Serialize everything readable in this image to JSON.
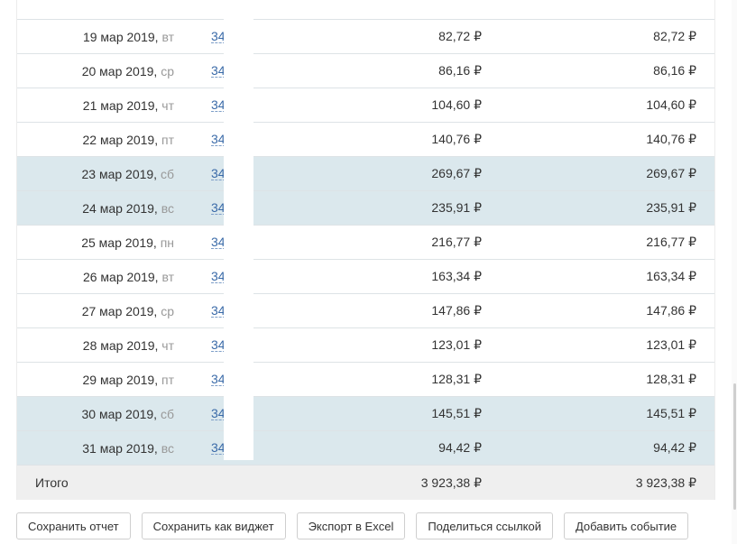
{
  "table": {
    "rows": [
      {
        "date": "19 мар 2019, ",
        "weekday": "вт",
        "link": "34",
        "col2": "82,72 ₽",
        "col3": "82,72 ₽",
        "weekend": false
      },
      {
        "date": "20 мар 2019, ",
        "weekday": "ср",
        "link": "34",
        "col2": "86,16 ₽",
        "col3": "86,16 ₽",
        "weekend": false
      },
      {
        "date": "21 мар 2019, ",
        "weekday": "чт",
        "link": "34",
        "col2": "104,60 ₽",
        "col3": "104,60 ₽",
        "weekend": false
      },
      {
        "date": "22 мар 2019, ",
        "weekday": "пт",
        "link": "34",
        "col2": "140,76 ₽",
        "col3": "140,76 ₽",
        "weekend": false
      },
      {
        "date": "23 мар 2019, ",
        "weekday": "сб",
        "link": "34",
        "col2": "269,67 ₽",
        "col3": "269,67 ₽",
        "weekend": true
      },
      {
        "date": "24 мар 2019, ",
        "weekday": "вс",
        "link": "34",
        "col2": "235,91 ₽",
        "col3": "235,91 ₽",
        "weekend": true
      },
      {
        "date": "25 мар 2019, ",
        "weekday": "пн",
        "link": "34",
        "col2": "216,77 ₽",
        "col3": "216,77 ₽",
        "weekend": false
      },
      {
        "date": "26 мар 2019, ",
        "weekday": "вт",
        "link": "34",
        "col2": "163,34 ₽",
        "col3": "163,34 ₽",
        "weekend": false
      },
      {
        "date": "27 мар 2019, ",
        "weekday": "ср",
        "link": "34",
        "col2": "147,86 ₽",
        "col3": "147,86 ₽",
        "weekend": false
      },
      {
        "date": "28 мар 2019, ",
        "weekday": "чт",
        "link": "34",
        "col2": "123,01 ₽",
        "col3": "123,01 ₽",
        "weekend": false
      },
      {
        "date": "29 мар 2019, ",
        "weekday": "пт",
        "link": "34",
        "col2": "128,31 ₽",
        "col3": "128,31 ₽",
        "weekend": false
      },
      {
        "date": "30 мар 2019, ",
        "weekday": "сб",
        "link": "34",
        "col2": "145,51 ₽",
        "col3": "145,51 ₽",
        "weekend": true
      },
      {
        "date": "31 мар 2019, ",
        "weekday": "вс",
        "link": "34",
        "col2": "94,42 ₽",
        "col3": "94,42 ₽",
        "weekend": true
      }
    ],
    "total": {
      "label": "Итого",
      "col2": "3 923,38 ₽",
      "col3": "3 923,38 ₽"
    }
  },
  "buttons": {
    "save_report": "Сохранить отчет",
    "save_widget": "Сохранить как виджет",
    "export_excel": "Экспорт в Excel",
    "share_link": "Поделиться ссылкой",
    "add_event": "Добавить событие"
  },
  "colors": {
    "weekend_row": "#dbe8ed",
    "link": "#3a6aa8",
    "total_row": "#efefef"
  }
}
